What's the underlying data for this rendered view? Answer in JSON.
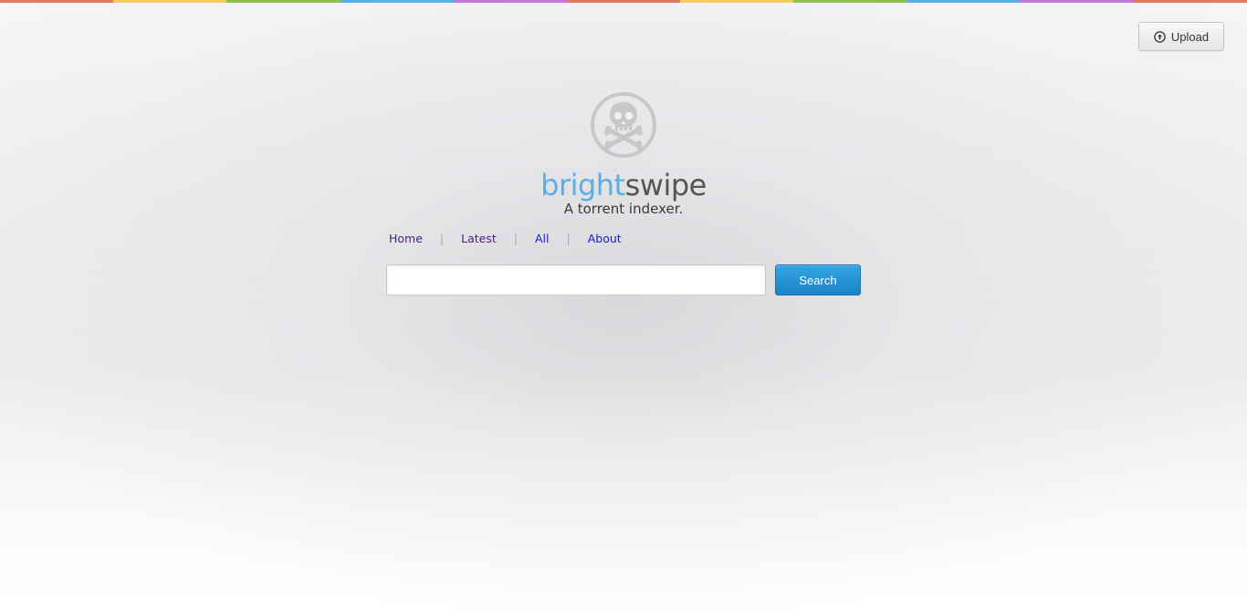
{
  "topbar": {
    "colors": [
      "#e07a5f",
      "#f2cc63",
      "#8cc152",
      "#5aaee8",
      "#c27ad6",
      "#e07a5f",
      "#f2cc63",
      "#8cc152",
      "#5aaee8",
      "#c27ad6",
      "#e07a5f"
    ]
  },
  "upload": {
    "label": "Upload",
    "icon": "upload-circle-icon"
  },
  "logo": {
    "icon": "skull-crossbones-icon",
    "color": "#c8c8c8"
  },
  "brand": {
    "part1": "bright",
    "part2": "swipe",
    "part1_color": "#5aaee8",
    "part2_color": "#555555"
  },
  "tagline": "A torrent indexer.",
  "nav": {
    "items": [
      {
        "label": "Home"
      },
      {
        "label": "Latest"
      },
      {
        "label": "All"
      },
      {
        "label": "About"
      }
    ],
    "separator": "|"
  },
  "search": {
    "value": "",
    "placeholder": "",
    "button_label": "Search",
    "button_color": "#1a83c8"
  }
}
